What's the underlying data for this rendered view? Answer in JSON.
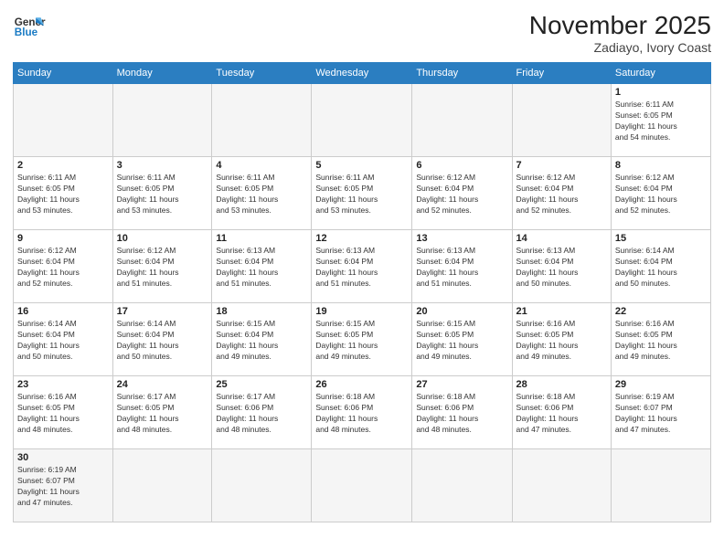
{
  "header": {
    "logo_line1": "General",
    "logo_line2": "Blue",
    "title": "November 2025",
    "subtitle": "Zadiayo, Ivory Coast"
  },
  "weekdays": [
    "Sunday",
    "Monday",
    "Tuesday",
    "Wednesday",
    "Thursday",
    "Friday",
    "Saturday"
  ],
  "weeks": [
    [
      {
        "day": "",
        "info": ""
      },
      {
        "day": "",
        "info": ""
      },
      {
        "day": "",
        "info": ""
      },
      {
        "day": "",
        "info": ""
      },
      {
        "day": "",
        "info": ""
      },
      {
        "day": "",
        "info": ""
      },
      {
        "day": "1",
        "info": "Sunrise: 6:11 AM\nSunset: 6:05 PM\nDaylight: 11 hours\nand 54 minutes."
      }
    ],
    [
      {
        "day": "2",
        "info": "Sunrise: 6:11 AM\nSunset: 6:05 PM\nDaylight: 11 hours\nand 53 minutes."
      },
      {
        "day": "3",
        "info": "Sunrise: 6:11 AM\nSunset: 6:05 PM\nDaylight: 11 hours\nand 53 minutes."
      },
      {
        "day": "4",
        "info": "Sunrise: 6:11 AM\nSunset: 6:05 PM\nDaylight: 11 hours\nand 53 minutes."
      },
      {
        "day": "5",
        "info": "Sunrise: 6:11 AM\nSunset: 6:05 PM\nDaylight: 11 hours\nand 53 minutes."
      },
      {
        "day": "6",
        "info": "Sunrise: 6:12 AM\nSunset: 6:04 PM\nDaylight: 11 hours\nand 52 minutes."
      },
      {
        "day": "7",
        "info": "Sunrise: 6:12 AM\nSunset: 6:04 PM\nDaylight: 11 hours\nand 52 minutes."
      },
      {
        "day": "8",
        "info": "Sunrise: 6:12 AM\nSunset: 6:04 PM\nDaylight: 11 hours\nand 52 minutes."
      }
    ],
    [
      {
        "day": "9",
        "info": "Sunrise: 6:12 AM\nSunset: 6:04 PM\nDaylight: 11 hours\nand 52 minutes."
      },
      {
        "day": "10",
        "info": "Sunrise: 6:12 AM\nSunset: 6:04 PM\nDaylight: 11 hours\nand 51 minutes."
      },
      {
        "day": "11",
        "info": "Sunrise: 6:13 AM\nSunset: 6:04 PM\nDaylight: 11 hours\nand 51 minutes."
      },
      {
        "day": "12",
        "info": "Sunrise: 6:13 AM\nSunset: 6:04 PM\nDaylight: 11 hours\nand 51 minutes."
      },
      {
        "day": "13",
        "info": "Sunrise: 6:13 AM\nSunset: 6:04 PM\nDaylight: 11 hours\nand 51 minutes."
      },
      {
        "day": "14",
        "info": "Sunrise: 6:13 AM\nSunset: 6:04 PM\nDaylight: 11 hours\nand 50 minutes."
      },
      {
        "day": "15",
        "info": "Sunrise: 6:14 AM\nSunset: 6:04 PM\nDaylight: 11 hours\nand 50 minutes."
      }
    ],
    [
      {
        "day": "16",
        "info": "Sunrise: 6:14 AM\nSunset: 6:04 PM\nDaylight: 11 hours\nand 50 minutes."
      },
      {
        "day": "17",
        "info": "Sunrise: 6:14 AM\nSunset: 6:04 PM\nDaylight: 11 hours\nand 50 minutes."
      },
      {
        "day": "18",
        "info": "Sunrise: 6:15 AM\nSunset: 6:04 PM\nDaylight: 11 hours\nand 49 minutes."
      },
      {
        "day": "19",
        "info": "Sunrise: 6:15 AM\nSunset: 6:05 PM\nDaylight: 11 hours\nand 49 minutes."
      },
      {
        "day": "20",
        "info": "Sunrise: 6:15 AM\nSunset: 6:05 PM\nDaylight: 11 hours\nand 49 minutes."
      },
      {
        "day": "21",
        "info": "Sunrise: 6:16 AM\nSunset: 6:05 PM\nDaylight: 11 hours\nand 49 minutes."
      },
      {
        "day": "22",
        "info": "Sunrise: 6:16 AM\nSunset: 6:05 PM\nDaylight: 11 hours\nand 49 minutes."
      }
    ],
    [
      {
        "day": "23",
        "info": "Sunrise: 6:16 AM\nSunset: 6:05 PM\nDaylight: 11 hours\nand 48 minutes."
      },
      {
        "day": "24",
        "info": "Sunrise: 6:17 AM\nSunset: 6:05 PM\nDaylight: 11 hours\nand 48 minutes."
      },
      {
        "day": "25",
        "info": "Sunrise: 6:17 AM\nSunset: 6:06 PM\nDaylight: 11 hours\nand 48 minutes."
      },
      {
        "day": "26",
        "info": "Sunrise: 6:18 AM\nSunset: 6:06 PM\nDaylight: 11 hours\nand 48 minutes."
      },
      {
        "day": "27",
        "info": "Sunrise: 6:18 AM\nSunset: 6:06 PM\nDaylight: 11 hours\nand 48 minutes."
      },
      {
        "day": "28",
        "info": "Sunrise: 6:18 AM\nSunset: 6:06 PM\nDaylight: 11 hours\nand 47 minutes."
      },
      {
        "day": "29",
        "info": "Sunrise: 6:19 AM\nSunset: 6:07 PM\nDaylight: 11 hours\nand 47 minutes."
      }
    ],
    [
      {
        "day": "30",
        "info": "Sunrise: 6:19 AM\nSunset: 6:07 PM\nDaylight: 11 hours\nand 47 minutes."
      },
      {
        "day": "",
        "info": ""
      },
      {
        "day": "",
        "info": ""
      },
      {
        "day": "",
        "info": ""
      },
      {
        "day": "",
        "info": ""
      },
      {
        "day": "",
        "info": ""
      },
      {
        "day": "",
        "info": ""
      }
    ]
  ]
}
